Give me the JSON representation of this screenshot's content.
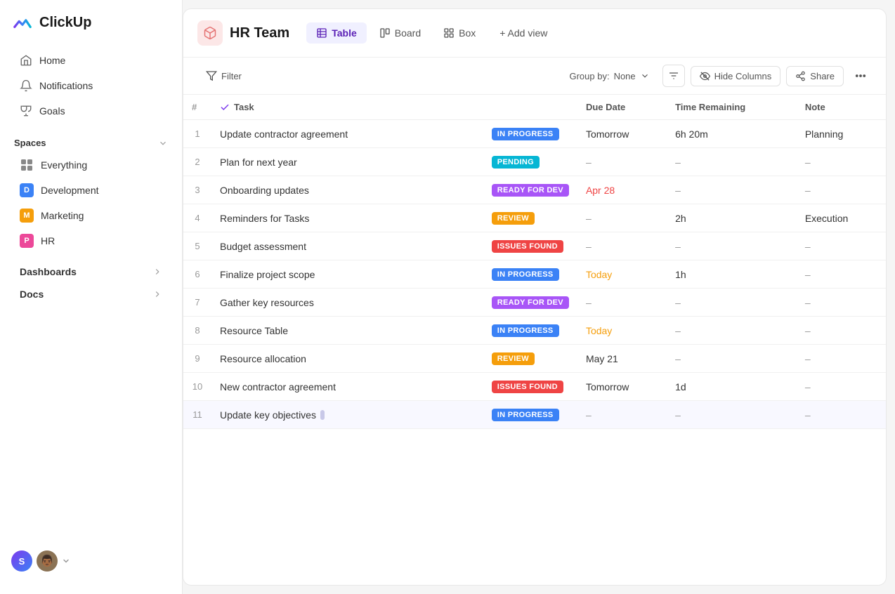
{
  "app": {
    "logo_text": "ClickUp"
  },
  "sidebar": {
    "nav_items": [
      {
        "id": "home",
        "label": "Home",
        "icon": "home-icon"
      },
      {
        "id": "notifications",
        "label": "Notifications",
        "icon": "bell-icon"
      },
      {
        "id": "goals",
        "label": "Goals",
        "icon": "trophy-icon"
      }
    ],
    "spaces_label": "Spaces",
    "spaces_chevron": "▾",
    "everything_label": "Everything",
    "space_items": [
      {
        "id": "development",
        "label": "Development",
        "initial": "D",
        "color": "#3b82f6"
      },
      {
        "id": "marketing",
        "label": "Marketing",
        "initial": "M",
        "color": "#f59e0b"
      },
      {
        "id": "hr",
        "label": "HR",
        "initial": "P",
        "color": "#ec4899"
      }
    ],
    "dashboards_label": "Dashboards",
    "docs_label": "Docs"
  },
  "header": {
    "workspace_title": "HR Team",
    "tabs": [
      {
        "id": "table",
        "label": "Table",
        "active": true
      },
      {
        "id": "board",
        "label": "Board",
        "active": false
      },
      {
        "id": "box",
        "label": "Box",
        "active": false
      }
    ],
    "add_view_label": "+ Add view"
  },
  "toolbar": {
    "filter_label": "Filter",
    "group_by_label": "Group by:",
    "group_by_value": "None",
    "hide_columns_label": "Hide Columns",
    "share_label": "Share"
  },
  "table": {
    "columns": [
      {
        "id": "num",
        "label": "#"
      },
      {
        "id": "task",
        "label": "Task"
      },
      {
        "id": "status",
        "label": ""
      },
      {
        "id": "due_date",
        "label": "Due Date"
      },
      {
        "id": "time_remaining",
        "label": "Time Remaining"
      },
      {
        "id": "note",
        "label": "Note"
      }
    ],
    "rows": [
      {
        "num": 1,
        "task": "Update contractor agreement",
        "status": "IN PROGRESS",
        "status_class": "badge-in-progress",
        "due_date": "Tomorrow",
        "due_class": "due-normal",
        "time_remaining": "6h 20m",
        "note": "Planning"
      },
      {
        "num": 2,
        "task": "Plan for next year",
        "status": "PENDING",
        "status_class": "badge-pending",
        "due_date": "–",
        "due_class": "due-dash",
        "time_remaining": "–",
        "note": "–"
      },
      {
        "num": 3,
        "task": "Onboarding updates",
        "status": "READY FOR DEV",
        "status_class": "badge-ready-for-dev",
        "due_date": "Apr 28",
        "due_class": "due-urgent",
        "time_remaining": "–",
        "note": "–"
      },
      {
        "num": 4,
        "task": "Reminders for Tasks",
        "status": "REVIEW",
        "status_class": "badge-review",
        "due_date": "–",
        "due_class": "due-dash",
        "time_remaining": "2h",
        "note": "Execution"
      },
      {
        "num": 5,
        "task": "Budget assessment",
        "status": "ISSUES FOUND",
        "status_class": "badge-issues-found",
        "due_date": "–",
        "due_class": "due-dash",
        "time_remaining": "–",
        "note": "–"
      },
      {
        "num": 6,
        "task": "Finalize project scope",
        "status": "IN PROGRESS",
        "status_class": "badge-in-progress",
        "due_date": "Today",
        "due_class": "due-today",
        "time_remaining": "1h",
        "note": "–"
      },
      {
        "num": 7,
        "task": "Gather key resources",
        "status": "READY FOR DEV",
        "status_class": "badge-ready-for-dev",
        "due_date": "–",
        "due_class": "due-dash",
        "time_remaining": "–",
        "note": "–"
      },
      {
        "num": 8,
        "task": "Resource Table",
        "status": "IN PROGRESS",
        "status_class": "badge-in-progress",
        "due_date": "Today",
        "due_class": "due-today",
        "time_remaining": "–",
        "note": "–"
      },
      {
        "num": 9,
        "task": "Resource allocation",
        "status": "REVIEW",
        "status_class": "badge-review",
        "due_date": "May 21",
        "due_class": "due-normal",
        "time_remaining": "–",
        "note": "–"
      },
      {
        "num": 10,
        "task": "New contractor agreement",
        "status": "ISSUES FOUND",
        "status_class": "badge-issues-found",
        "due_date": "Tomorrow",
        "due_class": "due-normal",
        "time_remaining": "1d",
        "note": "–"
      },
      {
        "num": 11,
        "task": "Update key objectives",
        "status": "IN PROGRESS",
        "status_class": "badge-in-progress",
        "due_date": "–",
        "due_class": "due-dash",
        "time_remaining": "–",
        "note": "–",
        "selected": true
      }
    ]
  },
  "user": {
    "initials": "S",
    "avatar_emoji": "👨🏾"
  }
}
